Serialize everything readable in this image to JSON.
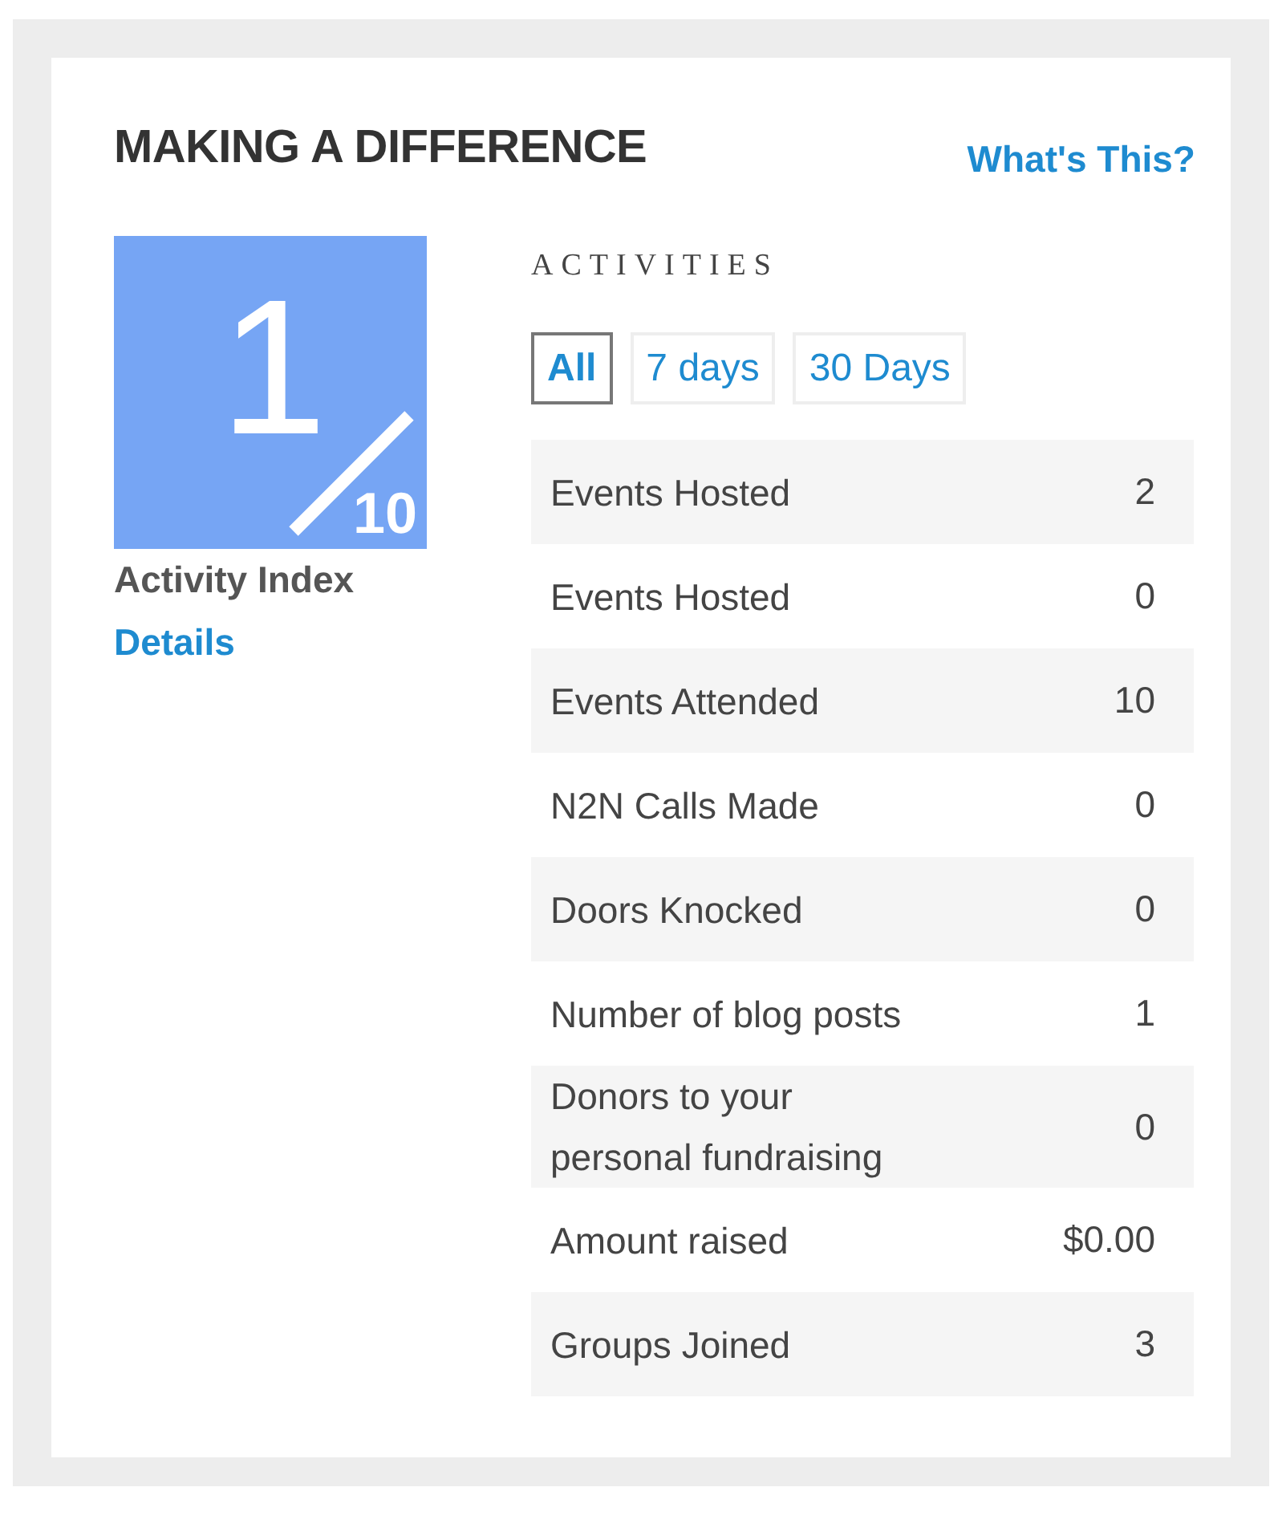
{
  "title": "MAKING A DIFFERENCE",
  "help_link": "What's This?",
  "index": {
    "value": "1",
    "out_of": "10",
    "label": "Activity Index",
    "details_link": "Details"
  },
  "activities": {
    "heading": "ACTIVITIES",
    "tabs": [
      {
        "label": "All",
        "selected": true
      },
      {
        "label": "7 days",
        "selected": false
      },
      {
        "label": "30 Days",
        "selected": false
      }
    ],
    "rows": [
      {
        "label": "Events Hosted",
        "value": "2"
      },
      {
        "label": "Events Hosted",
        "value": "0"
      },
      {
        "label": "Events Attended",
        "value": "10"
      },
      {
        "label": "N2N Calls Made",
        "value": "0"
      },
      {
        "label": "Doors Knocked",
        "value": "0"
      },
      {
        "label": "Number of blog posts",
        "value": "1"
      },
      {
        "label": "Donors to your personal fundraising",
        "value": "0"
      },
      {
        "label": "Amount raised",
        "value": "$0.00"
      },
      {
        "label": "Groups Joined",
        "value": "3"
      }
    ]
  }
}
